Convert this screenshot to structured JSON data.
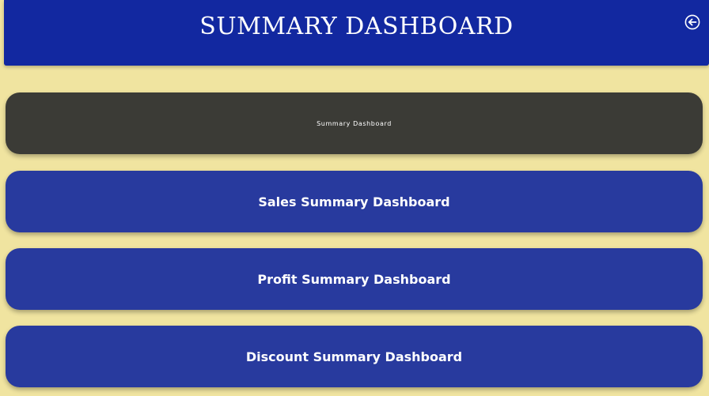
{
  "header": {
    "title": "SUMMARY DASHBOARD",
    "back_icon": "back-arrow-circle-icon"
  },
  "nav": {
    "items": [
      {
        "label": "Summary Dashboard",
        "state": "active"
      },
      {
        "label": "Sales Summary Dashboard",
        "state": "default"
      },
      {
        "label": "Profit Summary Dashboard",
        "state": "default"
      },
      {
        "label": "Discount Summary Dashboard",
        "state": "default"
      }
    ]
  },
  "colors": {
    "background": "#f0e4a0",
    "header": "#1228a0",
    "button": "#283a9e",
    "button_active": "#3b3b36",
    "text": "#ffffff"
  }
}
